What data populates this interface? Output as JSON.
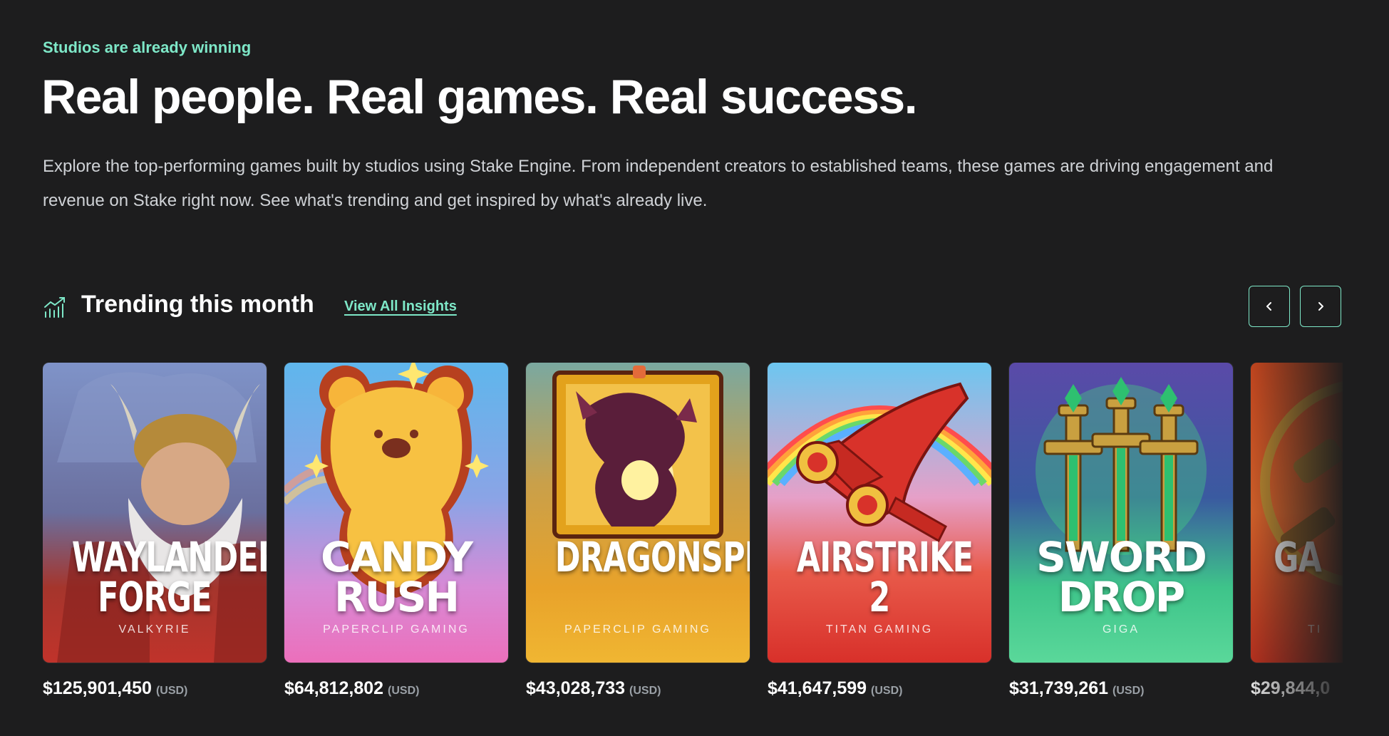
{
  "hero": {
    "eyebrow": "Studios are already winning",
    "headline": "Real people. Real games. Real success.",
    "intro": "Explore the top-performing games built by studios using Stake Engine. From independent creators to established teams, these games are driving engagement and revenue on Stake right now. See what's trending and get inspired by what's already live."
  },
  "trending": {
    "title": "Trending this month",
    "view_all": "View All Insights",
    "prev_icon": "chevron-left-icon",
    "next_icon": "chevron-right-icon",
    "accent": "#7ee8c8"
  },
  "games": [
    {
      "title": "WAYLANDERS\nFORGE",
      "studio": "VALKYRIE",
      "amount": "$125,901,450",
      "currency": "(USD)"
    },
    {
      "title": "CANDY\nRUSH",
      "studio": "PAPERCLIP GAMING",
      "amount": "$64,812,802",
      "currency": "(USD)"
    },
    {
      "title": "DRAGONSPIRE",
      "studio": "PAPERCLIP GAMING",
      "amount": "$43,028,733",
      "currency": "(USD)"
    },
    {
      "title": "AIRSTRIKE 2",
      "studio": "TITAN GAMING",
      "amount": "$41,647,599",
      "currency": "(USD)"
    },
    {
      "title": "SWORD\nDROP",
      "studio": "GIGA",
      "amount": "$31,739,261",
      "currency": "(USD)"
    },
    {
      "title": "GA",
      "studio": "TI",
      "amount": "$29,844,0",
      "currency": ""
    }
  ]
}
